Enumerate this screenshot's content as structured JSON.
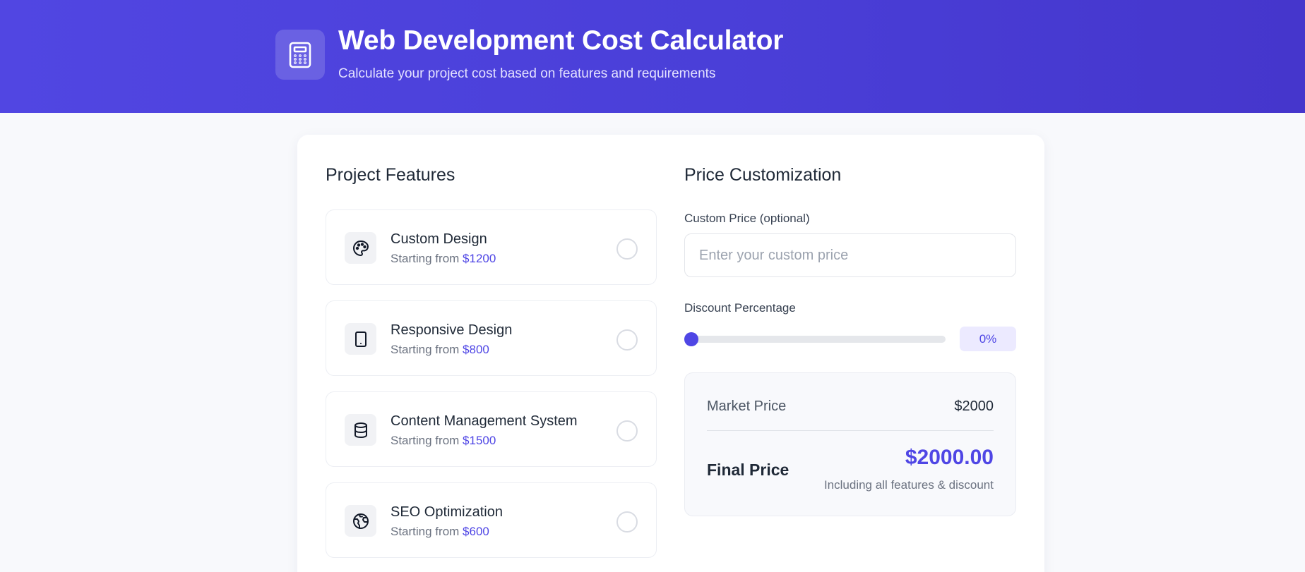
{
  "header": {
    "title": "Web Development Cost Calculator",
    "subtitle": "Calculate your project cost based on features and requirements",
    "icon": "calculator-icon"
  },
  "features": {
    "title": "Project Features",
    "items": [
      {
        "name": "Custom Design",
        "price_prefix": "Starting from",
        "price": "$1200",
        "icon": "palette-icon",
        "selected": false
      },
      {
        "name": "Responsive Design",
        "price_prefix": "Starting from",
        "price": "$800",
        "icon": "tablet-icon",
        "selected": false
      },
      {
        "name": "Content Management System",
        "price_prefix": "Starting from",
        "price": "$1500",
        "icon": "database-icon",
        "selected": false
      },
      {
        "name": "SEO Optimization",
        "price_prefix": "Starting from",
        "price": "$600",
        "icon": "globe-icon",
        "selected": false
      }
    ]
  },
  "customization": {
    "title": "Price Customization",
    "custom_price_label": "Custom Price (optional)",
    "custom_price_value": "",
    "custom_price_placeholder": "Enter your custom price",
    "discount_label": "Discount Percentage",
    "discount_value": 0,
    "discount_display": "0%"
  },
  "summary": {
    "market_label": "Market Price",
    "market_value": "$2000",
    "final_label": "Final Price",
    "final_value": "$2000.00",
    "final_note": "Including all features & discount"
  },
  "colors": {
    "accent": "#4f46e5",
    "header_gradient_start": "#5146e2",
    "header_gradient_end": "#4536cc"
  }
}
